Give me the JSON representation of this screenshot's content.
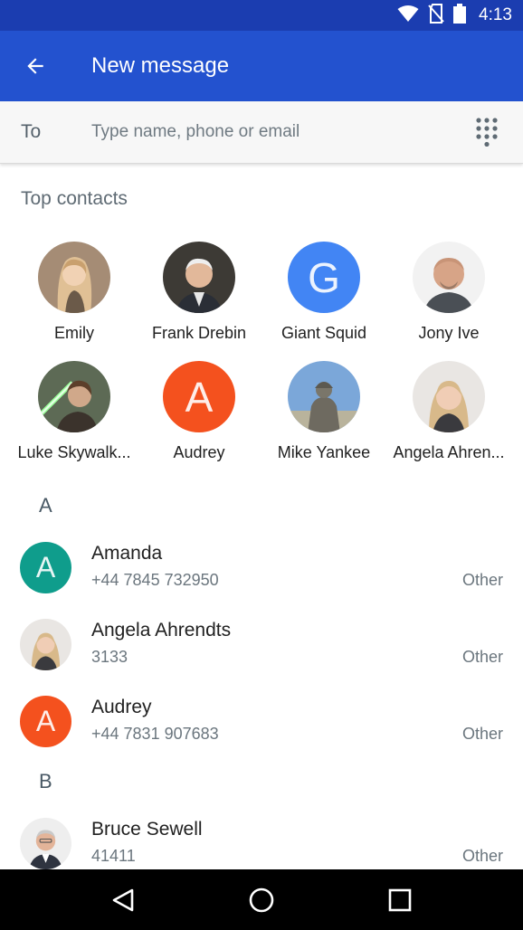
{
  "status": {
    "time": "4:13"
  },
  "header": {
    "title": "New message"
  },
  "to": {
    "label": "To",
    "placeholder": "Type name, phone or email"
  },
  "top_contacts": {
    "title": "Top contacts",
    "items": [
      {
        "name": "Emily",
        "avatar": "photo"
      },
      {
        "name": "Frank Drebin",
        "avatar": "photo"
      },
      {
        "name": "Giant Squid",
        "avatar": "letter",
        "letter": "G",
        "color": "#4285f4"
      },
      {
        "name": "Jony Ive",
        "avatar": "photo"
      },
      {
        "name": "Luke Skywalk...",
        "avatar": "photo"
      },
      {
        "name": "Audrey",
        "avatar": "letter",
        "letter": "A",
        "color": "#f4511e"
      },
      {
        "name": "Mike Yankee",
        "avatar": "photo"
      },
      {
        "name": "Angela Ahren...",
        "avatar": "photo"
      }
    ]
  },
  "contacts": {
    "sections": [
      {
        "letter": "A",
        "items": [
          {
            "name": "Amanda",
            "phone": "+44 7845 732950",
            "type": "Other",
            "avatar": "letter",
            "letter": "A",
            "color": "#0f9d8c"
          },
          {
            "name": "Angela Ahrendts",
            "phone": "3133",
            "type": "Other",
            "avatar": "photo"
          },
          {
            "name": "Audrey",
            "phone": "+44 7831 907683",
            "type": "Other",
            "avatar": "letter",
            "letter": "A",
            "color": "#f4511e"
          }
        ]
      },
      {
        "letter": "B",
        "items": [
          {
            "name": "Bruce Sewell",
            "phone": "41411",
            "type": "Other",
            "avatar": "photo"
          }
        ]
      }
    ]
  },
  "colors": {
    "status_bar": "#1b3db0",
    "app_bar": "#2352cf",
    "accent_teal": "#0f9d8c",
    "accent_orange": "#f4511e",
    "accent_blue": "#4285f4"
  }
}
